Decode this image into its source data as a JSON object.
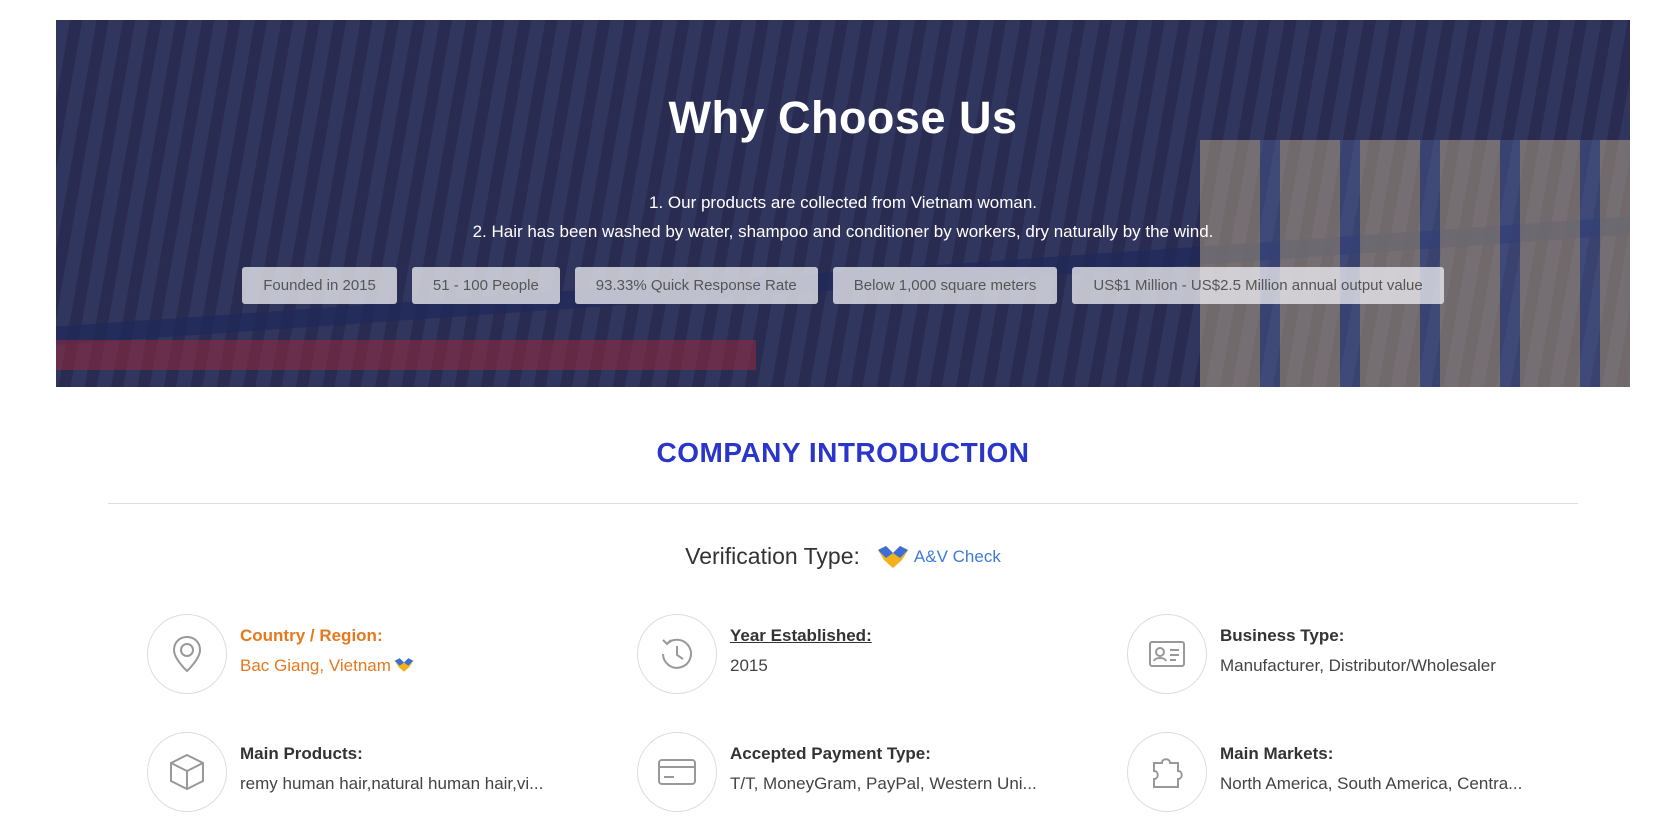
{
  "hero": {
    "title": "Why Choose Us",
    "line1": "1. Our products are collected from Vietnam woman.",
    "line2": "2. Hair has been washed by water, shampoo and conditioner by workers, dry naturally by the wind.",
    "chips": [
      "Founded in 2015",
      "51 - 100 People",
      "93.33% Quick Response Rate",
      "Below 1,000 square meters",
      "US$1 Million - US$2.5 Million annual output value"
    ]
  },
  "company": {
    "section_title": "COMPANY INTRODUCTION",
    "verification_label": "Verification Type:",
    "verification_link": "A&V Check",
    "items": [
      {
        "label": "Country / Region:",
        "value": "Bac Giang, Vietnam",
        "icon": "location-pin-icon"
      },
      {
        "label": "Year Established:",
        "value": "2015",
        "icon": "clock-history-icon"
      },
      {
        "label": "Business Type:",
        "value": "Manufacturer, Distributor/Wholesaler",
        "icon": "id-card-icon"
      },
      {
        "label": "Main Products:",
        "value": "remy human hair,natural human hair,vi...",
        "icon": "box-icon"
      },
      {
        "label": "Accepted Payment Type:",
        "value": "T/T, MoneyGram, PayPal, Western Uni...",
        "icon": "credit-card-icon"
      },
      {
        "label": "Main Markets:",
        "value": "North America, South America, Centra...",
        "icon": "puzzle-icon"
      }
    ]
  },
  "colors": {
    "accent_blue": "#2a35c9",
    "link_blue": "#3d7bd6",
    "highlight_orange": "#e5791e"
  }
}
